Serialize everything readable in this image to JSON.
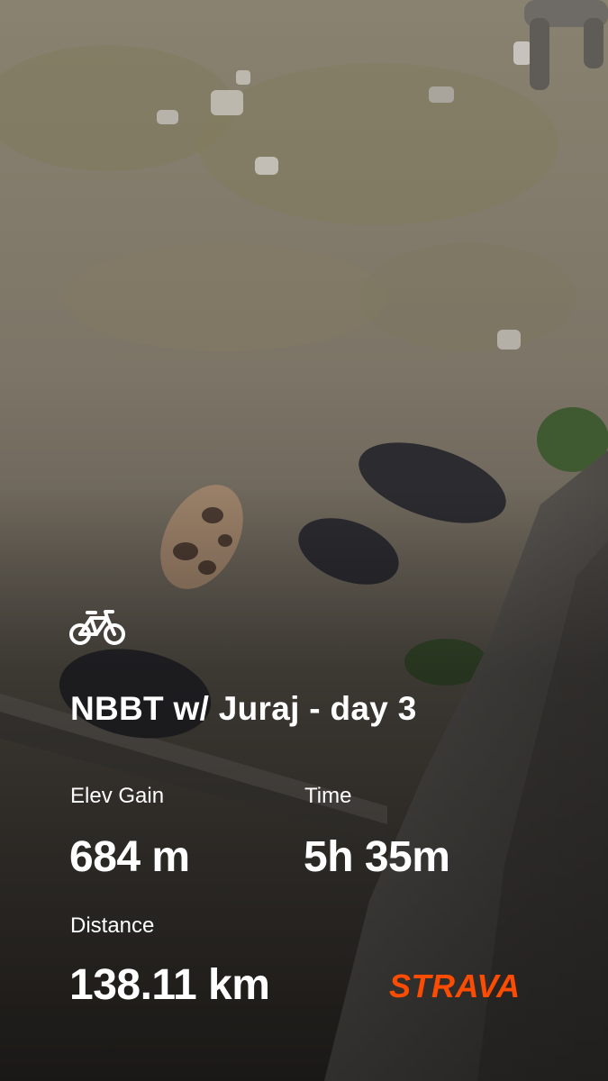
{
  "activity": {
    "sport_icon": "bicycle-icon",
    "title": "NBBT w/ Juraj - day 3"
  },
  "stats": {
    "elev_gain": {
      "label": "Elev Gain",
      "value": "684 m"
    },
    "time": {
      "label": "Time",
      "value": "5h 35m"
    },
    "distance": {
      "label": "Distance",
      "value": "138.11 km"
    }
  },
  "brand": {
    "name": "STRAVA",
    "color": "#fc4c02"
  },
  "colors": {
    "text": "#ffffff"
  }
}
